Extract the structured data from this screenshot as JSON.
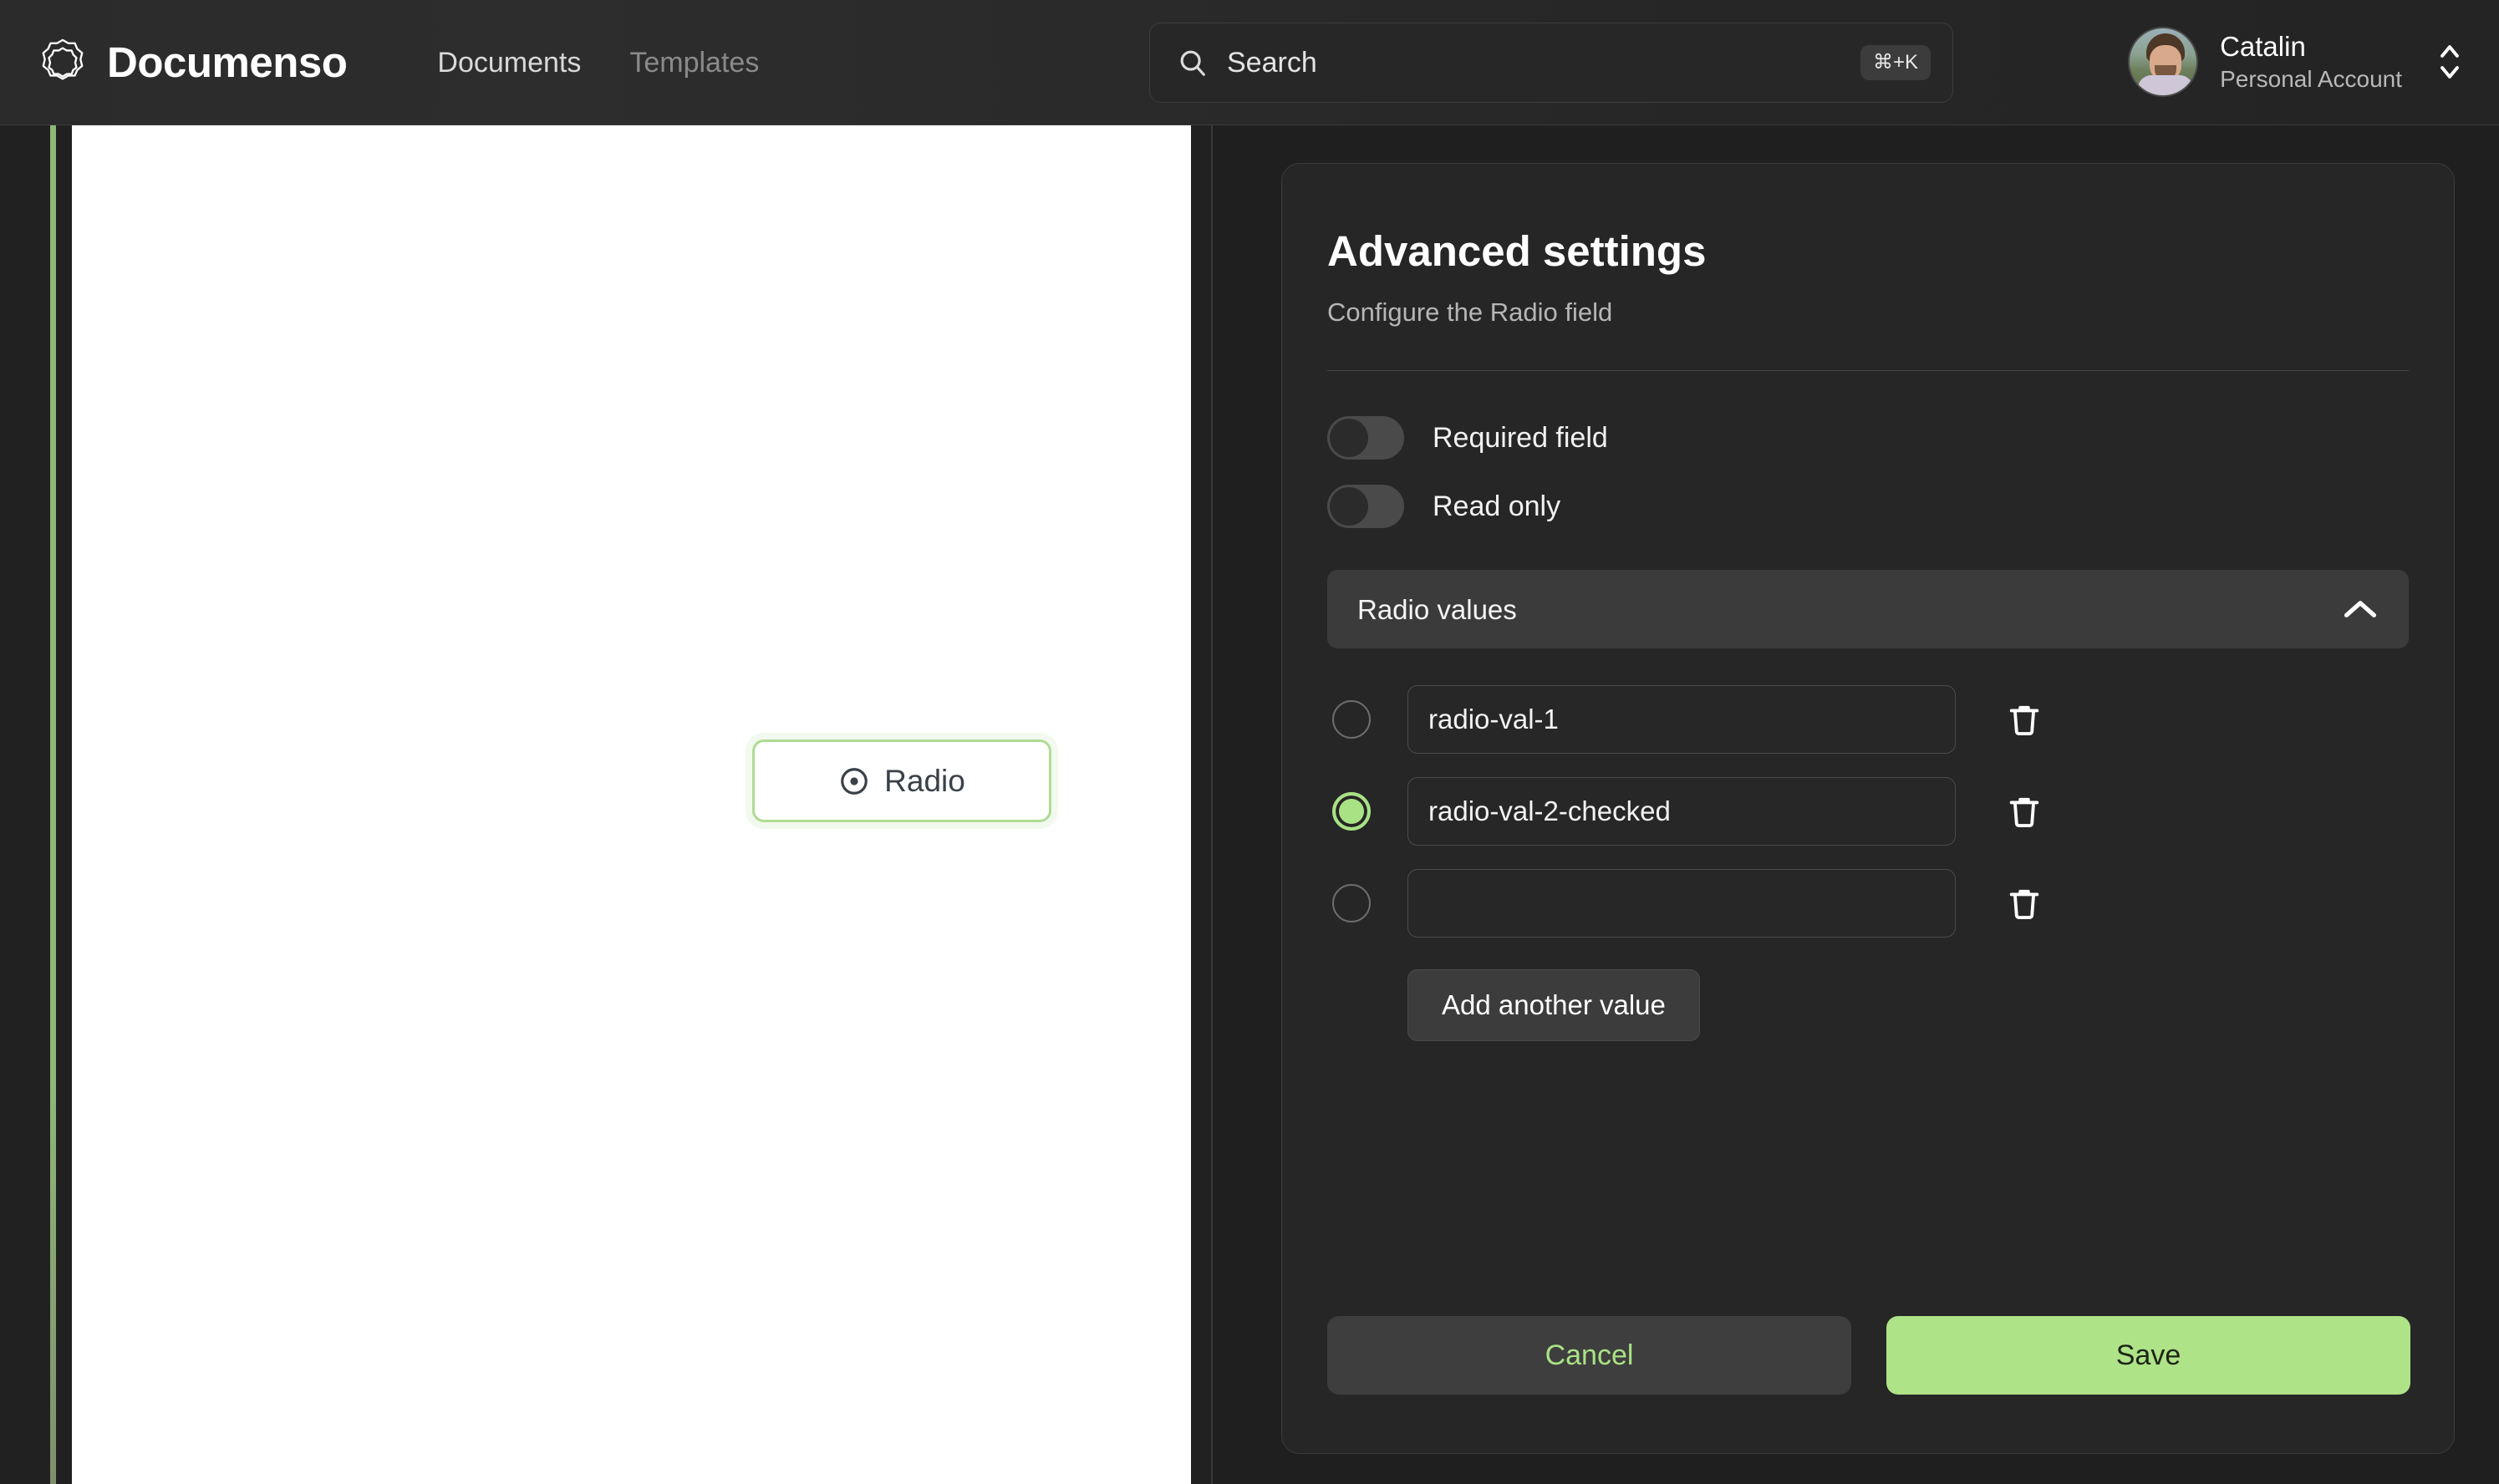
{
  "app": {
    "brand": "Documenso",
    "logo_icon": "documenso-rosette-logo"
  },
  "header": {
    "nav": [
      {
        "label": "Documents",
        "active": true
      },
      {
        "label": "Templates",
        "active": false
      }
    ],
    "search": {
      "placeholder": "Search",
      "icon": "search-icon",
      "shortcut": "⌘+K"
    },
    "account": {
      "name": "Catalin",
      "subtitle": "Personal Account",
      "avatar_icon": "user-avatar",
      "chevron_icon": "chevron-up-down-icon"
    }
  },
  "document": {
    "field": {
      "label": "Radio",
      "icon": "radio-button-icon",
      "accent_color": "#aedc93"
    }
  },
  "panel": {
    "title": "Advanced settings",
    "subtitle": "Configure the Radio field",
    "toggles": [
      {
        "label": "Required field",
        "enabled": false
      },
      {
        "label": "Read only",
        "enabled": false
      }
    ],
    "accordion": {
      "label": "Radio values",
      "expanded": true,
      "chevron_icon": "chevron-up-icon"
    },
    "values": [
      {
        "value": "radio-val-1",
        "checked": false,
        "delete_icon": "trash-icon"
      },
      {
        "value": "radio-val-2-checked",
        "checked": true,
        "delete_icon": "trash-icon"
      },
      {
        "value": "",
        "checked": false,
        "delete_icon": "trash-icon"
      }
    ],
    "add_value_label": "Add another value",
    "cancel_label": "Cancel",
    "save_label": "Save"
  },
  "colors": {
    "accent_green": "#a9e285",
    "save_bg": "#aee388",
    "panel_bg": "#262626",
    "app_bg": "#1f1f1f"
  }
}
